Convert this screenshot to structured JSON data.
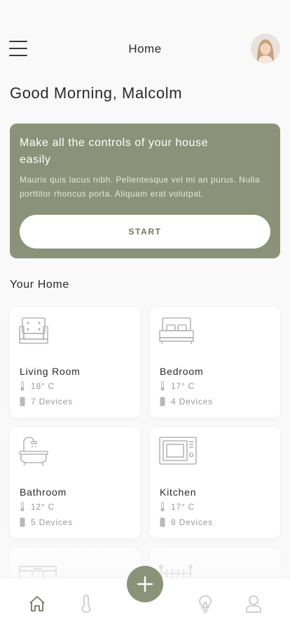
{
  "header": {
    "title": "Home"
  },
  "greeting": "Good Morning, Malcolm",
  "promo": {
    "title": "Make all the controls of your house easily",
    "text": "Mauris quis lacus nibh. Pellentesque vel mi an purus. Nulla porttitor rhoncus porta. Aliquam erat volutpat.",
    "button": "START"
  },
  "section_title": "Your Home",
  "rooms": [
    {
      "name": "Living Room",
      "temp": "18° C",
      "devices": "7 Devices",
      "icon": "sofa-icon"
    },
    {
      "name": "Bedroom",
      "temp": "17° C",
      "devices": "4 Devices",
      "icon": "bed-icon"
    },
    {
      "name": "Bathroom",
      "temp": "12° C",
      "devices": "5 Devices",
      "icon": "bathtub-icon"
    },
    {
      "name": "Kitchen",
      "temp": "17° C",
      "devices": "8 Devices",
      "icon": "microwave-icon"
    }
  ],
  "nav": [
    "home-icon",
    "thermometer-icon",
    "add-icon",
    "lightbulb-icon",
    "profile-icon"
  ],
  "colors": {
    "accent": "#8a937a",
    "background": "#f9f9f9",
    "card": "#ffffff",
    "muted_text": "#9a9a9a"
  }
}
